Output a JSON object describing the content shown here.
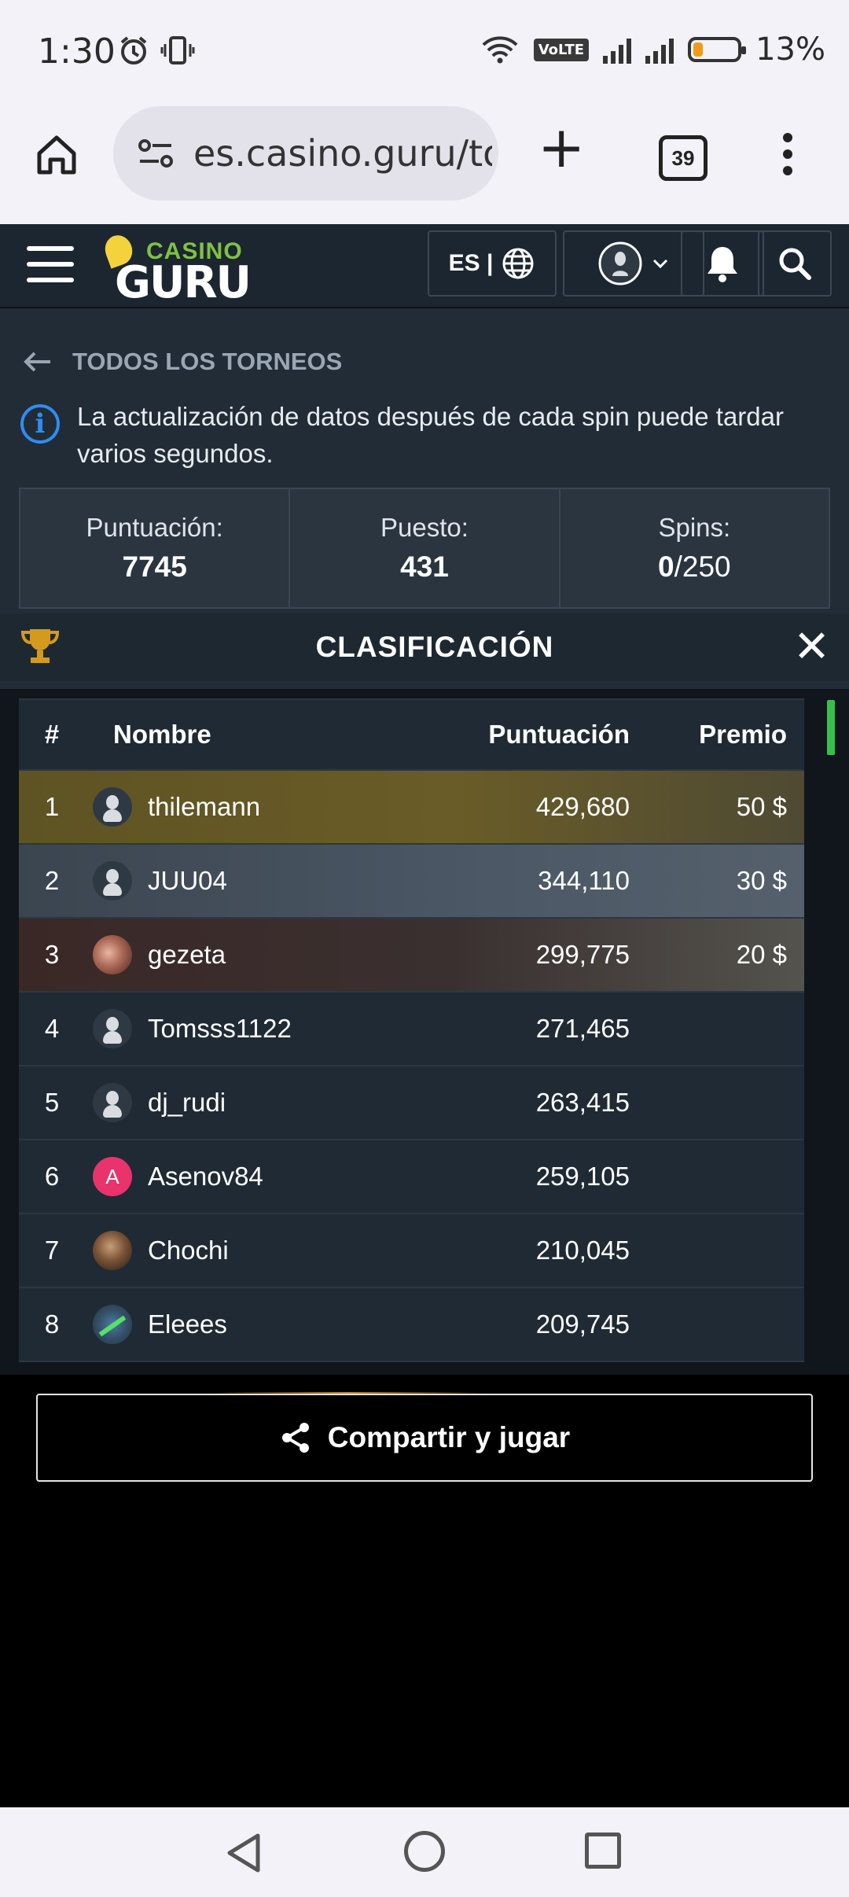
{
  "status_bar": {
    "time": "1:30",
    "volte": "VoLTE",
    "battery_percent": "13%",
    "battery_level": 0.13
  },
  "browser": {
    "url": "es.casino.guru/to",
    "tab_count": "39"
  },
  "site_header": {
    "logo_casino": "CASINO",
    "logo_guru": "GURU",
    "lang": "ES |"
  },
  "tournament": {
    "back_label": "TODOS LOS TORNEOS",
    "info_text": "La actualización de datos después de cada spin puede tardar varios segundos.",
    "stats": {
      "score_label": "Puntuación:",
      "score_value": "7745",
      "rank_label": "Puesto:",
      "rank_value": "431",
      "spins_label": "Spins:",
      "spins_used": "0",
      "spins_total": "/250"
    },
    "leaderboard_title": "CLASIFICACIÓN"
  },
  "leaderboard": {
    "columns": {
      "rank": "#",
      "name": "Nombre",
      "score": "Puntuación",
      "prize": "Premio"
    },
    "rows": [
      {
        "rank": "1",
        "name": "thilemann",
        "score": "429,680",
        "prize": "50 $"
      },
      {
        "rank": "2",
        "name": "JUU04",
        "score": "344,110",
        "prize": "30 $"
      },
      {
        "rank": "3",
        "name": "gezeta",
        "score": "299,775",
        "prize": "20 $"
      },
      {
        "rank": "4",
        "name": "Tomsss1122",
        "score": "271,465",
        "prize": ""
      },
      {
        "rank": "5",
        "name": "dj_rudi",
        "score": "263,415",
        "prize": ""
      },
      {
        "rank": "6",
        "name": "Asenov84",
        "score": "259,105",
        "prize": "",
        "avatar_letter": "A"
      },
      {
        "rank": "7",
        "name": "Chochi",
        "score": "210,045",
        "prize": ""
      },
      {
        "rank": "8",
        "name": "Eleees",
        "score": "209,745",
        "prize": ""
      }
    ]
  },
  "share_button": {
    "label": "Compartir y jugar"
  },
  "colors": {
    "accent_green": "#7fc241",
    "info_blue": "#2f8cf2",
    "gold_row": "#6a5c28",
    "silver_row": "#4c5866",
    "bronze_row": "#3a3030"
  }
}
